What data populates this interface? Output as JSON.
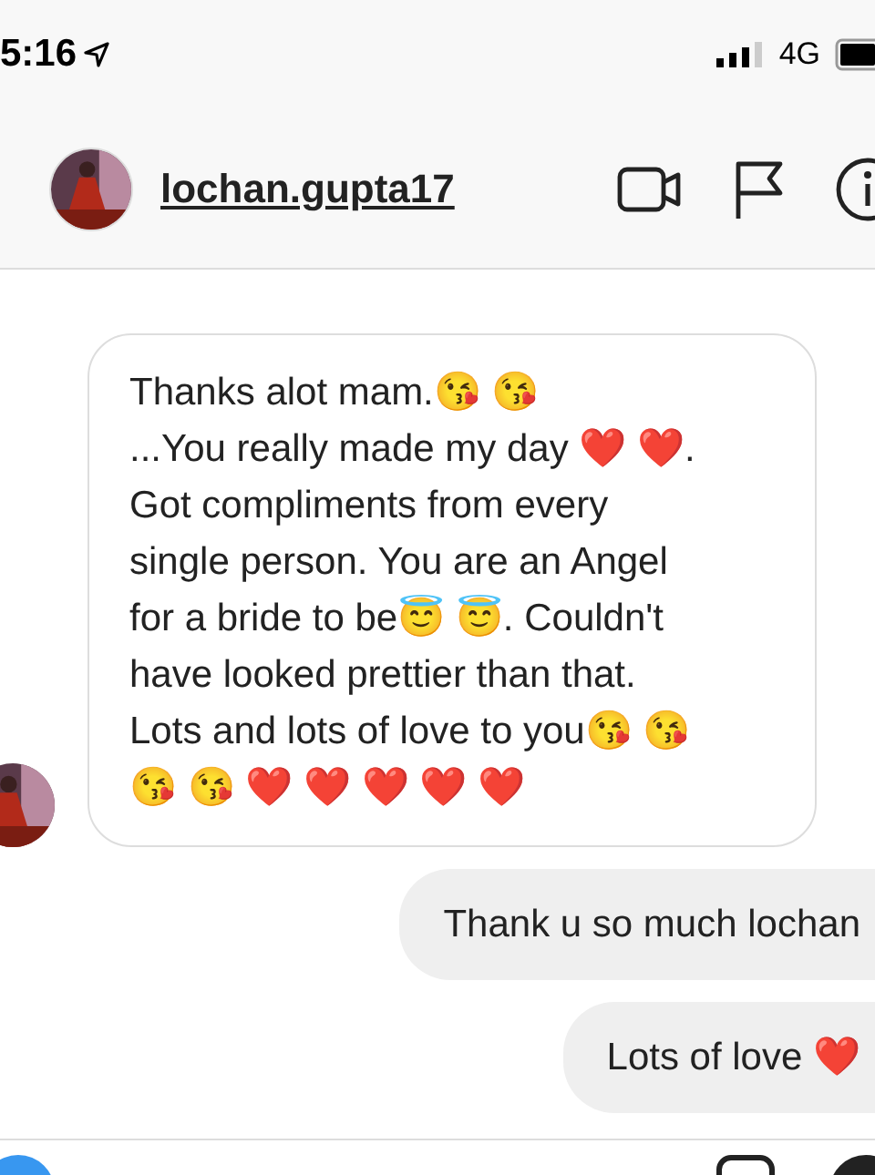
{
  "status_bar": {
    "time": "5:16",
    "network": "4G"
  },
  "header": {
    "username": "lochan.gupta17"
  },
  "messages": [
    {
      "kind": "received",
      "lines": [
        "Thanks alot mam.😘 😘",
        "...You really made my day ❤️ ❤️.",
        "Got compliments from every",
        "single person. You are an Angel",
        "for a bride to be😇 😇. Couldn't",
        "have looked prettier than that.",
        "Lots and lots of love to you😘 😘",
        "😘 😘 ❤️ ❤️ ❤️ ❤️ ❤️"
      ]
    },
    {
      "kind": "sent",
      "lines": [
        "Thank u so much lochan"
      ]
    },
    {
      "kind": "sent",
      "lines": [
        "Lots of love ❤️"
      ]
    }
  ]
}
